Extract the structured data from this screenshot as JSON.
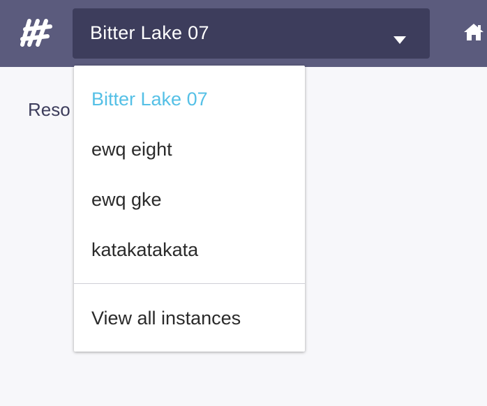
{
  "header": {
    "logo_icon": "brand-logo-icon",
    "instance_selector": {
      "selected": "Bitter Lake 07",
      "caret_icon": "caret-down-icon"
    },
    "home_icon": "home-icon"
  },
  "content": {
    "heading_partial": "Reso"
  },
  "dropdown": {
    "items": [
      {
        "label": "Bitter Lake 07",
        "selected": true
      },
      {
        "label": "ewq eight",
        "selected": false
      },
      {
        "label": "ewq gke",
        "selected": false
      },
      {
        "label": "katakatakata",
        "selected": false
      }
    ],
    "footer_link": "View all instances"
  },
  "colors": {
    "topbar": "#5b5b7d",
    "select_bg": "#3d3d5c",
    "selected_item": "#55c0e6",
    "page_bg": "#f7f7fa"
  }
}
